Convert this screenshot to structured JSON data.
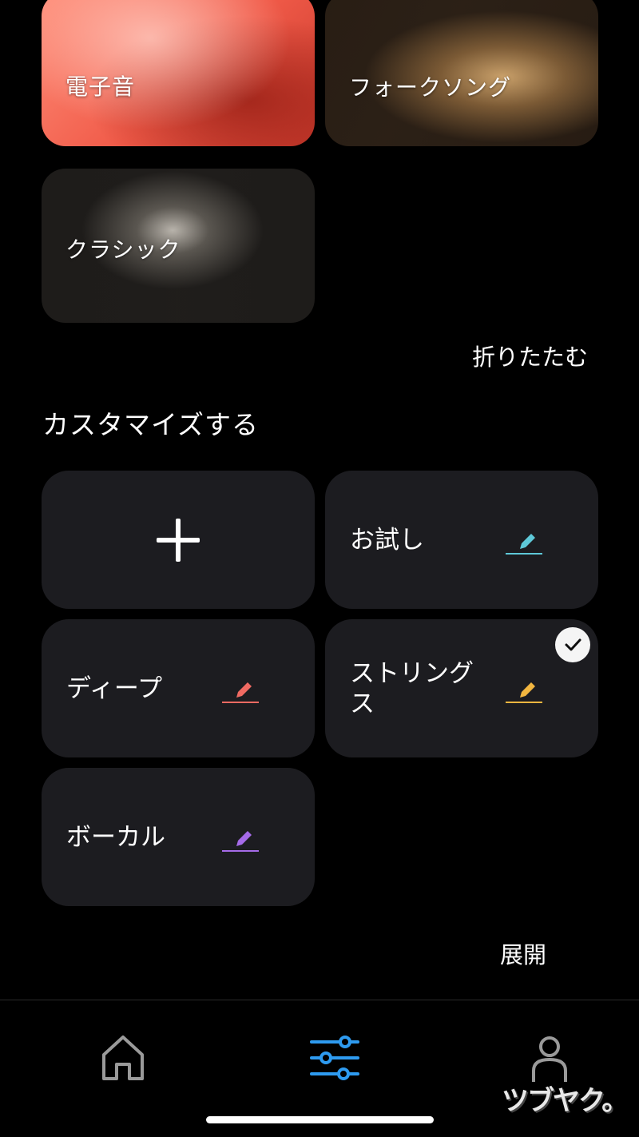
{
  "genres": [
    {
      "label": "電子音"
    },
    {
      "label": "フォークソング"
    },
    {
      "label": "クラシック"
    }
  ],
  "collapse_label": "折りたたむ",
  "customize": {
    "title": "カスタマイズする",
    "presets": [
      {
        "name": "お試し",
        "pencil_color": "#5ec8d8"
      },
      {
        "name": "ディープ",
        "pencil_color": "#f06a62"
      },
      {
        "name": "ストリングス",
        "pencil_color": "#f2b640",
        "selected": true
      },
      {
        "name": "ボーカル",
        "pencil_color": "#a56be8"
      }
    ]
  },
  "expand_label": "展開",
  "tabs": {
    "home": "home-icon",
    "equalizer": "sliders-icon",
    "profile": "person-icon",
    "active_color": "#2e9bf0"
  },
  "watermark": "ツブヤク。"
}
